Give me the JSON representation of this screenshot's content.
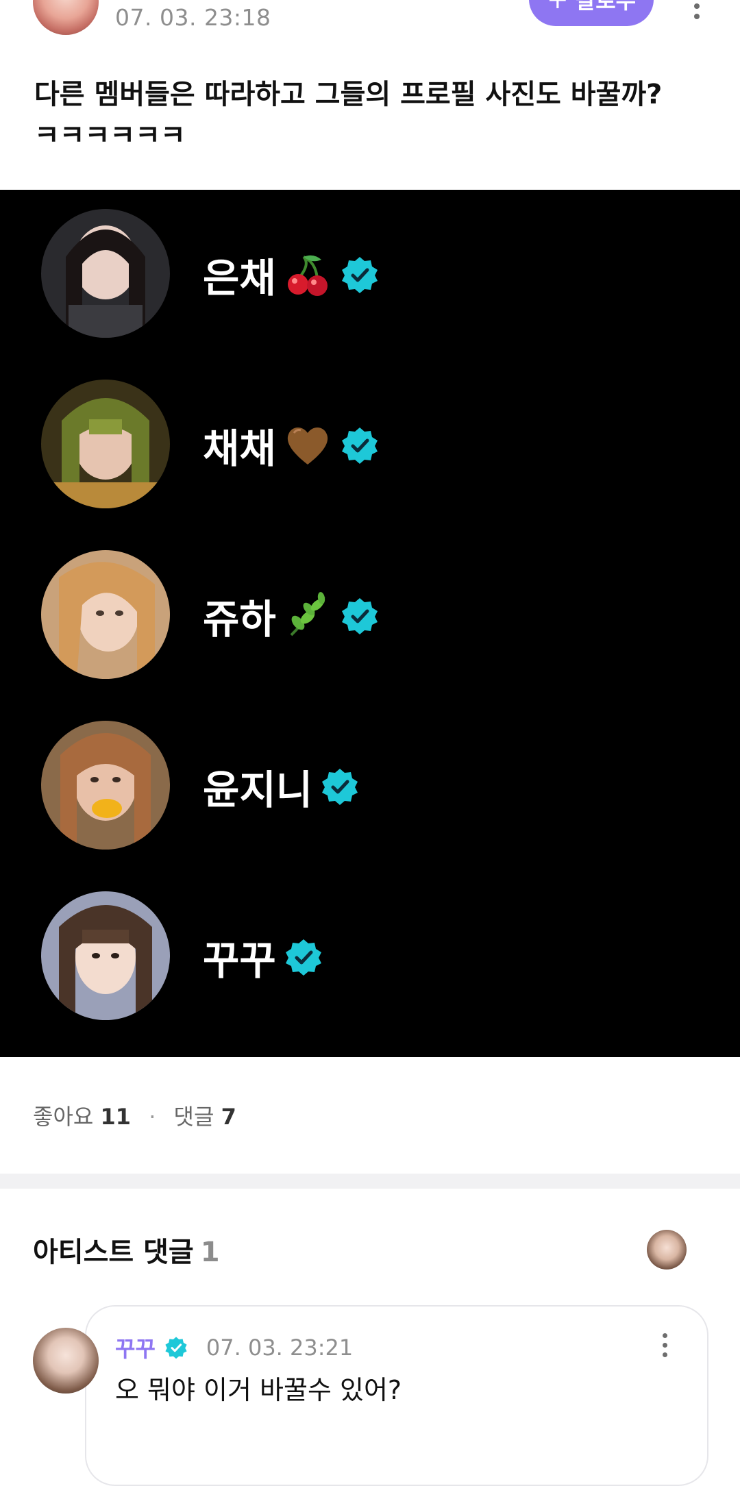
{
  "post": {
    "time": "07. 03. 23:18",
    "follow_label": "팔로우",
    "body_line1": "다른 멤버들은 따라하고 그들의 프로필 사진도 바꿀까?",
    "body_line2": "ㅋㅋㅋㅋㅋㅋ"
  },
  "members": [
    {
      "name": "은채",
      "emoji": "cherries-emoji"
    },
    {
      "name": "채채",
      "emoji": "brown-heart-emoji"
    },
    {
      "name": "쥬하",
      "emoji": "herb-emoji"
    },
    {
      "name": "윤지니",
      "emoji": ""
    },
    {
      "name": "꾸꾸",
      "emoji": ""
    }
  ],
  "stats": {
    "likes_label": "좋아요",
    "likes_count": "11",
    "comments_label": "댓글",
    "comments_count": "7"
  },
  "artist_comments": {
    "title": "아티스트 댓글",
    "count": "1",
    "comment": {
      "author": "꾸꾸",
      "time": "07. 03. 23:21",
      "text": "오 뭐야 이거 바꿀수 있어?"
    }
  },
  "colors": {
    "accent": "#8e76f2",
    "verified": "#1ec8d8",
    "image_background": "#000000"
  }
}
